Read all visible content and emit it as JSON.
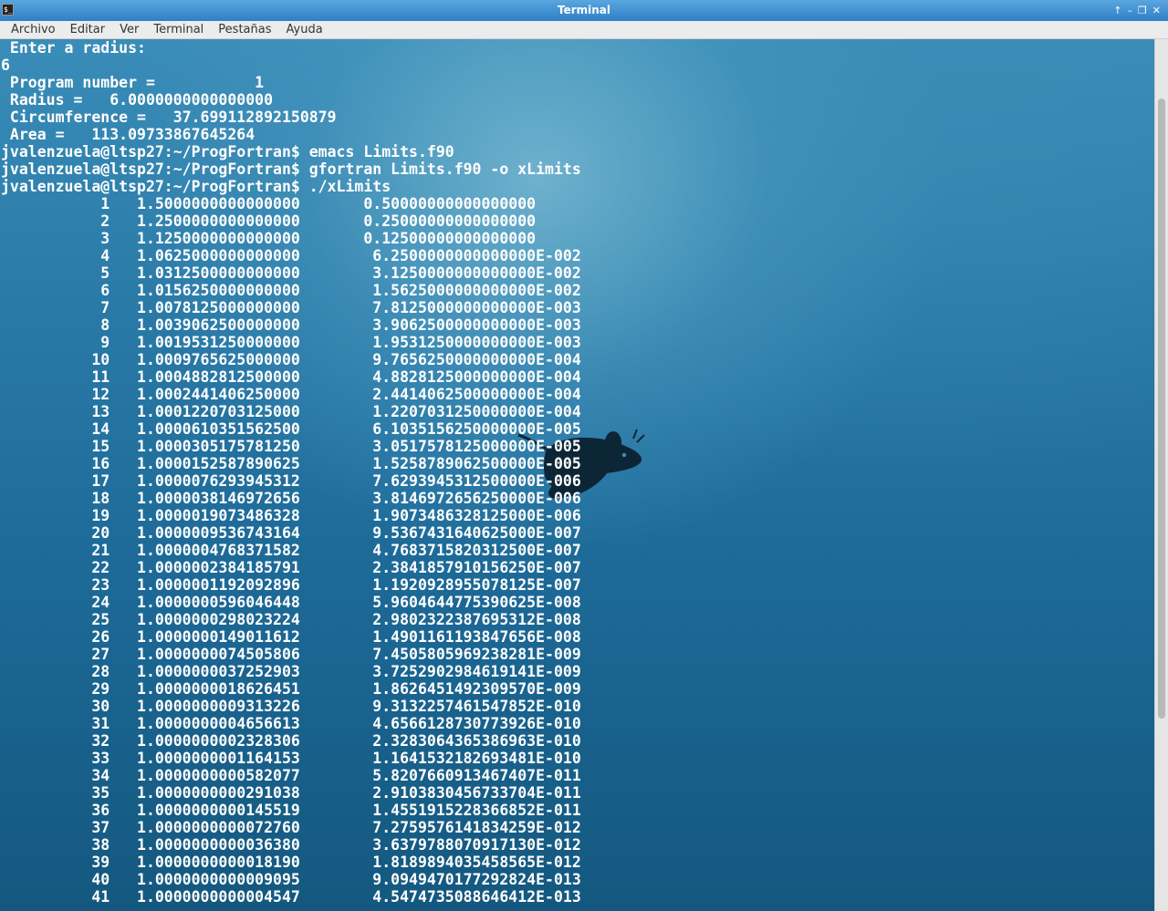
{
  "window": {
    "title": "Terminal",
    "app_icon": "terminal-icon",
    "controls": [
      "up-arrow-icon",
      "minimize-icon",
      "restore-icon",
      "close-icon"
    ]
  },
  "menubar": [
    "Archivo",
    "Editar",
    "Ver",
    "Terminal",
    "Pestañas",
    "Ayuda"
  ],
  "terminal_lines": [
    " Enter a radius:",
    "6",
    " Program number =           1",
    " Radius =   6.0000000000000000     ",
    " Circumference =   37.699112892150879     ",
    " Area =   113.09733867645264     ",
    "jvalenzuela@ltsp27:~/ProgFortran$ emacs Limits.f90",
    "jvalenzuela@ltsp27:~/ProgFortran$ gfortran Limits.f90 -o xLimits",
    "jvalenzuela@ltsp27:~/ProgFortran$ ./xLimits",
    "           1   1.5000000000000000       0.50000000000000000     ",
    "           2   1.2500000000000000       0.25000000000000000     ",
    "           3   1.1250000000000000       0.12500000000000000     ",
    "           4   1.0625000000000000        6.2500000000000000E-002",
    "           5   1.0312500000000000        3.1250000000000000E-002",
    "           6   1.0156250000000000        1.5625000000000000E-002",
    "           7   1.0078125000000000        7.8125000000000000E-003",
    "           8   1.0039062500000000        3.9062500000000000E-003",
    "           9   1.0019531250000000        1.9531250000000000E-003",
    "          10   1.0009765625000000        9.7656250000000000E-004",
    "          11   1.0004882812500000        4.8828125000000000E-004",
    "          12   1.0002441406250000        2.4414062500000000E-004",
    "          13   1.0001220703125000        1.2207031250000000E-004",
    "          14   1.0000610351562500        6.1035156250000000E-005",
    "          15   1.0000305175781250        3.0517578125000000E-005",
    "          16   1.0000152587890625        1.5258789062500000E-005",
    "          17   1.0000076293945312        7.6293945312500000E-006",
    "          18   1.0000038146972656        3.8146972656250000E-006",
    "          19   1.0000019073486328        1.9073486328125000E-006",
    "          20   1.0000009536743164        9.5367431640625000E-007",
    "          21   1.0000004768371582        4.7683715820312500E-007",
    "          22   1.0000002384185791        2.3841857910156250E-007",
    "          23   1.0000001192092896        1.1920928955078125E-007",
    "          24   1.0000000596046448        5.9604644775390625E-008",
    "          25   1.0000000298023224        2.9802322387695312E-008",
    "          26   1.0000000149011612        1.4901161193847656E-008",
    "          27   1.0000000074505806        7.4505805969238281E-009",
    "          28   1.0000000037252903        3.7252902984619141E-009",
    "          29   1.0000000018626451        1.8626451492309570E-009",
    "          30   1.0000000009313226        9.3132257461547852E-010",
    "          31   1.0000000004656613        4.6566128730773926E-010",
    "          32   1.0000000002328306        2.3283064365386963E-010",
    "          33   1.0000000001164153        1.1641532182693481E-010",
    "          34   1.0000000000582077        5.8207660913467407E-011",
    "          35   1.0000000000291038        2.9103830456733704E-011",
    "          36   1.0000000000145519        1.4551915228366852E-011",
    "          37   1.0000000000072760        7.2759576141834259E-012",
    "          38   1.0000000000036380        3.6379788070917130E-012",
    "          39   1.0000000000018190        1.8189894035458565E-012",
    "          40   1.0000000000009095        9.0949470177292824E-013",
    "          41   1.0000000000004547        4.5474735088646412E-013"
  ],
  "scrollbar": {
    "position": 0.93
  },
  "colors": {
    "titlebar": "#3a8fd2",
    "text": "#ffffff",
    "wallpaper": "#1d6a98"
  }
}
